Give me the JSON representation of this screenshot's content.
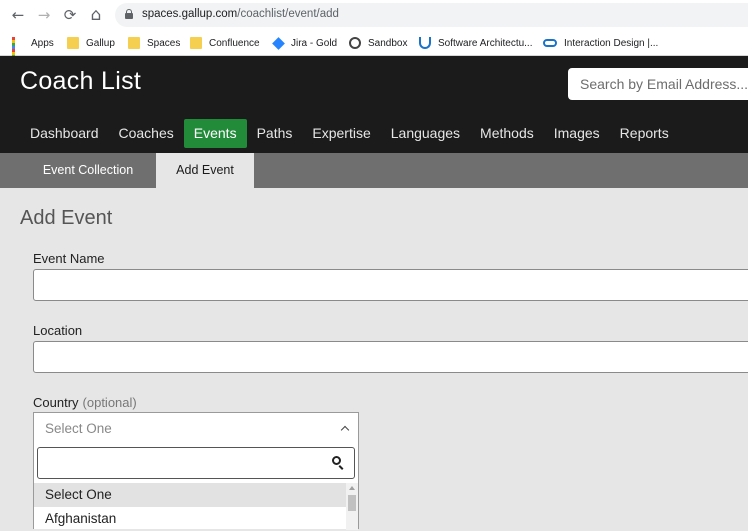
{
  "browser": {
    "url_host": "spaces.gallup.com",
    "url_path": "/coachlist/event/add",
    "back_glyph": "←",
    "forward_glyph": "→",
    "reload_glyph": "⟳",
    "home_glyph": "⌂"
  },
  "bookmarks": [
    {
      "label": "Apps",
      "icon": "apps-grid-icon"
    },
    {
      "label": "Gallup",
      "icon": "folder-icon"
    },
    {
      "label": "Spaces",
      "icon": "folder-icon"
    },
    {
      "label": "Confluence",
      "icon": "folder-icon"
    },
    {
      "label": "Jira - Gold",
      "icon": "jira-icon"
    },
    {
      "label": "Sandbox",
      "icon": "globe-icon"
    },
    {
      "label": "Software Architectu...",
      "icon": "udemy-icon"
    },
    {
      "label": "Interaction Design |...",
      "icon": "link-icon"
    }
  ],
  "header": {
    "app_title": "Coach List",
    "search_placeholder": "Search by Email Address..."
  },
  "nav": {
    "items": [
      "Dashboard",
      "Coaches",
      "Events",
      "Paths",
      "Expertise",
      "Languages",
      "Methods",
      "Images",
      "Reports"
    ],
    "active": "Events"
  },
  "subnav": {
    "tabs": [
      "Event Collection",
      "Add Event"
    ],
    "active": "Add Event"
  },
  "form": {
    "title": "Add Event",
    "event_name_label": "Event Name",
    "event_name_value": "",
    "location_label": "Location",
    "location_value": "",
    "country_label": "Country",
    "country_optional": "(optional)",
    "country_selected": "Select One",
    "country_search_value": "",
    "country_options": [
      "Select One",
      "Afghanistan"
    ]
  },
  "colors": {
    "header_bg": "#1b1b1b",
    "active_nav": "#228b3a",
    "subnav_bg": "#6f6f6f",
    "page_bg": "#e6e6e6",
    "folder": "#f5cf4f",
    "jira": "#2684ff"
  }
}
